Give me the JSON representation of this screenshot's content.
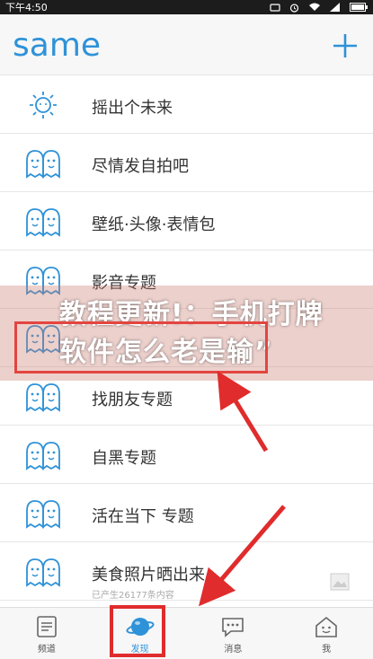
{
  "statusbar": {
    "time": "下午4:50"
  },
  "appbar": {
    "logo": "same"
  },
  "list": [
    {
      "label": "摇出个未来",
      "icon": "sun-icon"
    },
    {
      "label": "尽情发自拍吧",
      "icon": "ghost-icon"
    },
    {
      "label": "壁纸·头像·表情包",
      "icon": "ghost-icon"
    },
    {
      "label": "影音专题",
      "icon": "ghost-icon"
    },
    {
      "label": "",
      "icon": "ghost-icon"
    },
    {
      "label": "找朋友专题",
      "icon": "ghost-icon"
    },
    {
      "label": "自黑专题",
      "icon": "ghost-icon"
    },
    {
      "label": "活在当下 专题",
      "icon": "ghost-icon"
    },
    {
      "label": "美食照片晒出来",
      "sub": "已产生26177条内容",
      "icon": "ghost-icon"
    }
  ],
  "tabs": [
    {
      "label": "频道",
      "icon": "doc-icon"
    },
    {
      "label": "发现",
      "icon": "planet-icon",
      "active": true
    },
    {
      "label": "消息",
      "icon": "chat-icon"
    },
    {
      "label": "我",
      "icon": "home-face-icon"
    }
  ],
  "overlay": {
    "title": "教程更新!：手机打牌软件怎么老是输”"
  },
  "colors": {
    "accent": "#2e92d8",
    "red": "#e02c2c"
  }
}
